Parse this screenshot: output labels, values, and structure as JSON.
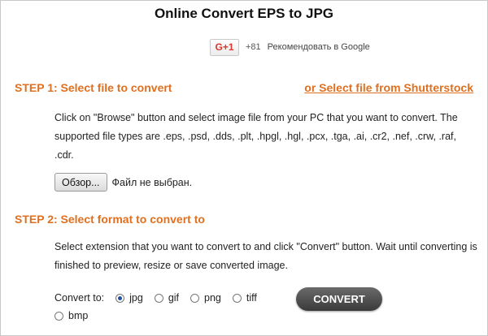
{
  "title": "Online Convert EPS to JPG",
  "google": {
    "button_label": "G+1",
    "count": "+81",
    "text": "Рекомендовать в Google"
  },
  "step1": {
    "heading": "STEP 1: Select file to convert",
    "shutterstock_link": "or Select file from Shutterstock",
    "description": "Click on \"Browse\" button and select image file from your PC that you want to convert. The supported file types are .eps, .psd, .dds, .plt, .hpgl, .hgl, .pcx, .tga, .ai, .cr2, .nef, .crw, .raf, .cdr.",
    "browse_label": "Обзор...",
    "file_status": "Файл не выбран."
  },
  "step2": {
    "heading": "STEP 2: Select format to convert to",
    "description": "Select extension that you want to convert to and click \"Convert\" button. Wait until converting is finished to preview, resize or save converted image.",
    "convert_to_label": "Convert to:",
    "formats": [
      "jpg",
      "gif",
      "png",
      "tiff",
      "bmp"
    ],
    "selected_format": "jpg",
    "convert_button": "CONVERT"
  },
  "colors": {
    "accent_orange": "#e07020",
    "google_red": "#d9382e",
    "convert_button": "#4a4a4a"
  }
}
